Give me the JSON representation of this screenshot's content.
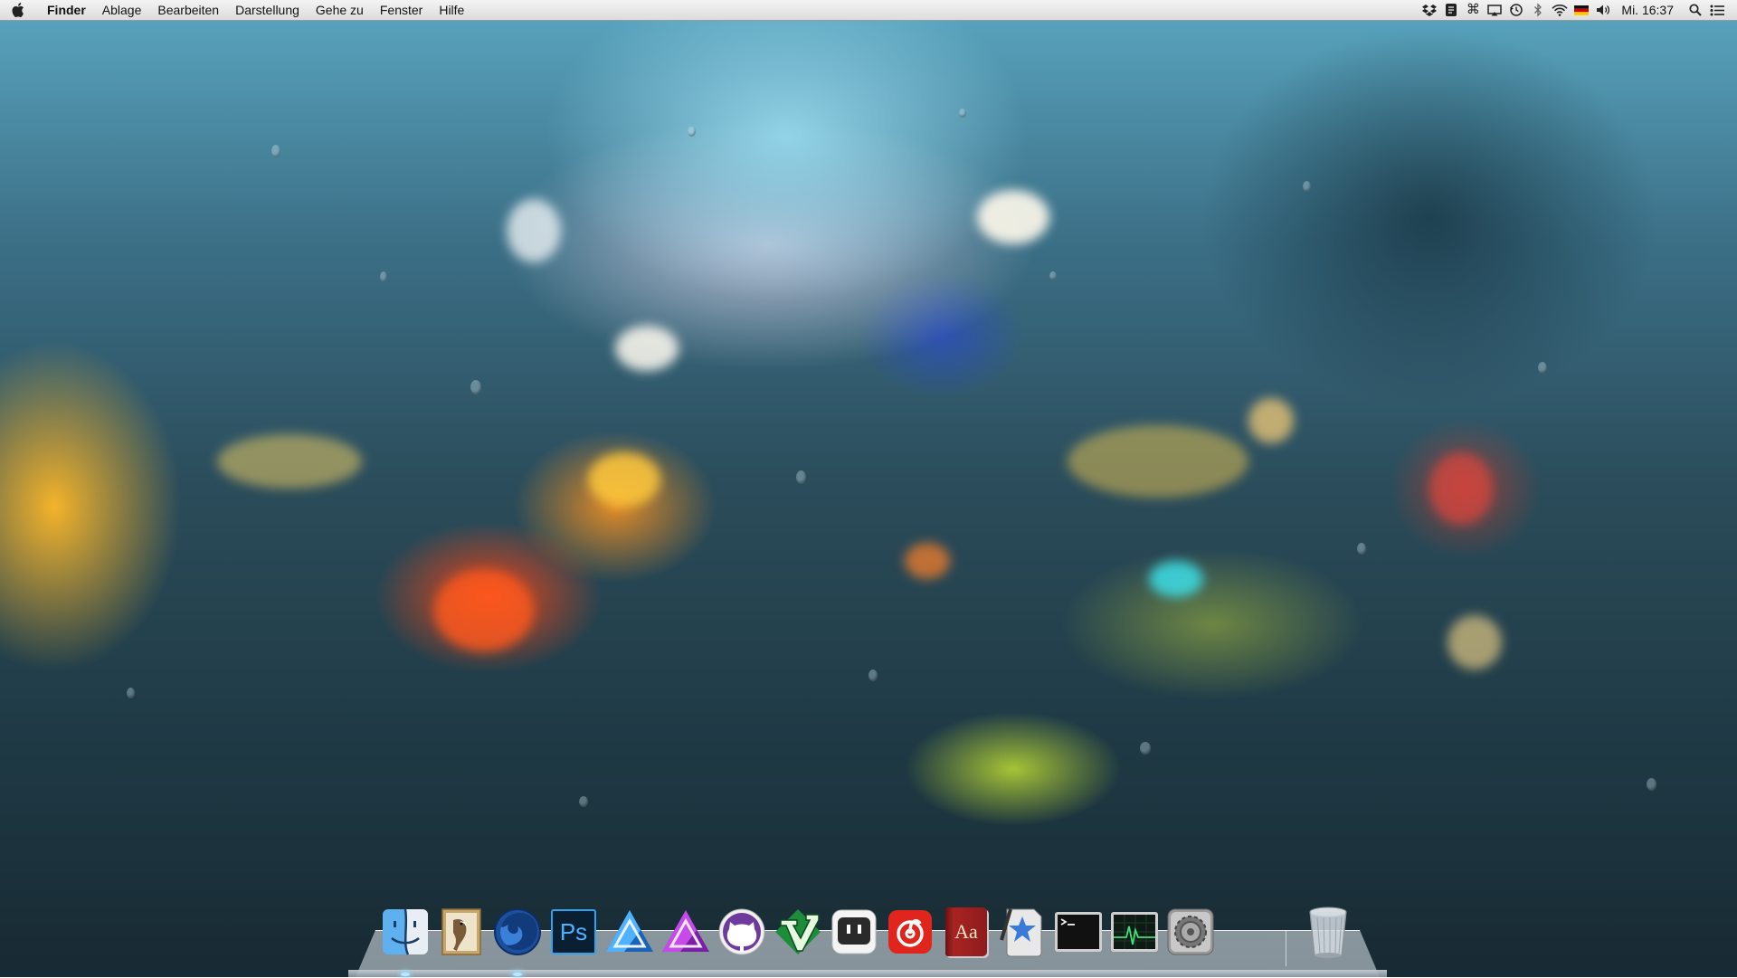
{
  "menubar": {
    "apple_icon": "apple-logo-icon",
    "app_name": "Finder",
    "menus": [
      "Ablage",
      "Bearbeiten",
      "Darstellung",
      "Gehe zu",
      "Fenster",
      "Hilfe"
    ],
    "status_icons": [
      "dropbox-icon",
      "evernote-icon",
      "command-key-icon",
      "airplay-icon",
      "time-machine-icon",
      "bluetooth-icon",
      "wifi-icon",
      "german-flag-icon",
      "volume-icon"
    ],
    "clock": "Mi. 16:37",
    "spotlight_icon": "spotlight-search-icon",
    "notification_icon": "notification-center-icon"
  },
  "dock": {
    "apps": [
      {
        "name": "Finder",
        "icon": "finder-icon",
        "running": true
      },
      {
        "name": "Mail",
        "icon": "mail-icon",
        "running": false
      },
      {
        "name": "Firefox",
        "icon": "firefox-icon",
        "running": true
      },
      {
        "name": "Photoshop",
        "icon": "photoshop-icon",
        "label": "Ps",
        "running": false
      },
      {
        "name": "Affinity Designer",
        "icon": "affinity-designer-icon",
        "running": false
      },
      {
        "name": "Affinity Photo",
        "icon": "affinity-photo-icon",
        "running": false
      },
      {
        "name": "GitHub",
        "icon": "github-icon",
        "running": false
      },
      {
        "name": "Vim",
        "icon": "vim-icon",
        "running": false
      },
      {
        "name": "Pocket",
        "icon": "pocket-icon",
        "running": false
      },
      {
        "name": "NetEase Music",
        "icon": "netease-music-icon",
        "running": false
      },
      {
        "name": "Dictionary",
        "icon": "dictionary-icon",
        "label": "Aa",
        "running": false
      },
      {
        "name": "Instruments",
        "icon": "instruments-icon",
        "running": false
      },
      {
        "name": "Terminal",
        "icon": "terminal-icon",
        "running": false
      },
      {
        "name": "Activity Monitor",
        "icon": "activity-monitor-icon",
        "running": false
      },
      {
        "name": "System Preferences",
        "icon": "system-preferences-icon",
        "running": false
      }
    ],
    "trash": {
      "name": "Trash",
      "icon": "trash-icon"
    }
  },
  "wallpaper": {
    "description_icon": "rainy-window-wallpaper"
  }
}
